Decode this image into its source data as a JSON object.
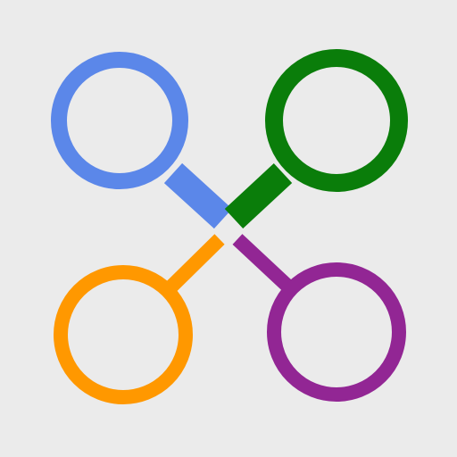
{
  "logo": {
    "background": "#ebebeb",
    "outline": "#f7f7f7",
    "colors": {
      "blue": "#5b87e9",
      "green": "#0a7d0a",
      "orange": "#ff9800",
      "purple": "#922694"
    }
  }
}
